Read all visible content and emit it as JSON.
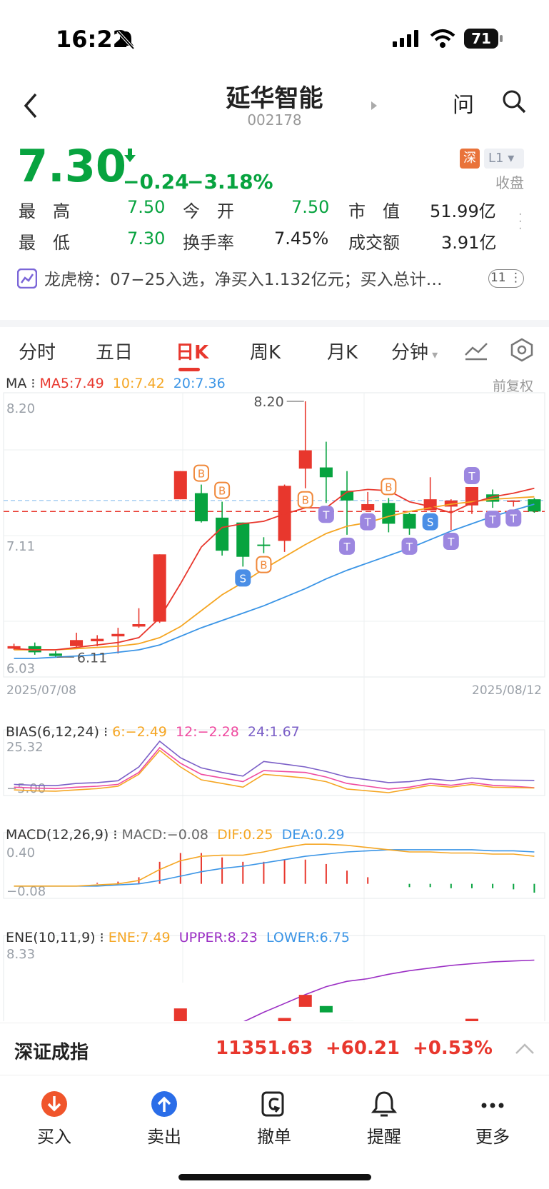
{
  "status_bar": {
    "time": "16:22",
    "battery": "71"
  },
  "header": {
    "title": "延华智能",
    "code": "002178",
    "ask": "问"
  },
  "quote": {
    "price": "7.30",
    "change": "−0.24",
    "change_pct": "−3.18%",
    "market_tag": "深",
    "level_tag": "L1",
    "state": "收盘",
    "rows": [
      [
        {
          "label": "最　高",
          "value": "7.50",
          "color": "green"
        },
        {
          "label": "今　开",
          "value": "7.50",
          "color": "green"
        },
        {
          "label": "市　值",
          "value": "51.99亿",
          "color": "dark"
        }
      ],
      [
        {
          "label": "最　低",
          "value": "7.30",
          "color": "green"
        },
        {
          "label": "换手率",
          "value": "7.45%",
          "color": "dark"
        },
        {
          "label": "成交额",
          "value": "3.91亿",
          "color": "dark"
        }
      ]
    ],
    "dragon_tiger": "龙虎榜：07−25入选，净买入1.132亿元；买入总计…",
    "dragon_tiger_count": "11"
  },
  "tabs": [
    "分时",
    "五日",
    "日K",
    "周K",
    "月K",
    "分钟"
  ],
  "active_tab": "日K",
  "chart_data": {
    "type": "candlestick",
    "adjust": "前复权",
    "ma_header": {
      "label": "MA",
      "ma5": "MA5:7.49",
      "ma10": "10:7.42",
      "ma20": "20:7.36"
    },
    "y_top_label": "8.20",
    "y_mid_label": "7.11",
    "y_bottom_label": "6.03",
    "high_label": "8.20",
    "low_label": "6.11",
    "start_date": "2025/07/08",
    "end_date": "2025/08/12",
    "ylim": [
      6.03,
      8.2
    ],
    "candles": [
      {
        "o": 6.18,
        "c": 6.2,
        "h": 6.22,
        "l": 6.17
      },
      {
        "o": 6.2,
        "c": 6.15,
        "h": 6.23,
        "l": 6.13
      },
      {
        "o": 6.14,
        "c": 6.12,
        "h": 6.16,
        "l": 6.11
      },
      {
        "o": 6.2,
        "c": 6.25,
        "h": 6.31,
        "l": 6.19
      },
      {
        "o": 6.24,
        "c": 6.26,
        "h": 6.29,
        "l": 6.2
      },
      {
        "o": 6.28,
        "c": 6.3,
        "h": 6.35,
        "l": 6.14
      },
      {
        "o": 6.36,
        "c": 6.38,
        "h": 6.51,
        "l": 6.35
      },
      {
        "o": 6.4,
        "c": 6.95,
        "h": 6.95,
        "l": 6.39
      },
      {
        "o": 7.4,
        "c": 7.63,
        "h": 7.63,
        "l": 7.4
      },
      {
        "o": 7.45,
        "c": 7.22,
        "h": 7.52,
        "l": 7.21
      },
      {
        "o": 7.25,
        "c": 6.98,
        "h": 7.38,
        "l": 6.94
      },
      {
        "o": 7.21,
        "c": 6.93,
        "h": 7.21,
        "l": 6.85
      },
      {
        "o": 7.03,
        "c": 7.02,
        "h": 7.09,
        "l": 6.96
      },
      {
        "o": 7.06,
        "c": 7.51,
        "h": 7.52,
        "l": 6.97
      },
      {
        "o": 7.65,
        "c": 7.8,
        "h": 8.2,
        "l": 7.49
      },
      {
        "o": 7.66,
        "c": 7.58,
        "h": 7.87,
        "l": 7.37
      },
      {
        "o": 7.47,
        "c": 7.39,
        "h": 7.63,
        "l": 7.11
      },
      {
        "o": 7.31,
        "c": 7.36,
        "h": 7.46,
        "l": 7.31
      },
      {
        "o": 7.37,
        "c": 7.2,
        "h": 7.41,
        "l": 7.13
      },
      {
        "o": 7.28,
        "c": 7.16,
        "h": 7.29,
        "l": 7.11
      },
      {
        "o": 7.31,
        "c": 7.4,
        "h": 7.58,
        "l": 7.31
      },
      {
        "o": 7.34,
        "c": 7.39,
        "h": 7.4,
        "l": 7.15
      },
      {
        "o": 7.35,
        "c": 7.5,
        "h": 7.5,
        "l": 7.28
      },
      {
        "o": 7.44,
        "c": 7.38,
        "h": 7.48,
        "l": 7.33
      },
      {
        "o": 7.39,
        "c": 7.39,
        "h": 7.39,
        "l": 7.34
      },
      {
        "o": 7.4,
        "c": 7.3,
        "h": 7.41,
        "l": 7.29
      }
    ],
    "ma5": [
      6.18,
      6.17,
      6.17,
      6.19,
      6.21,
      6.23,
      6.27,
      6.43,
      6.71,
      7.01,
      7.17,
      7.2,
      7.22,
      7.28,
      7.33,
      7.33,
      7.46,
      7.48,
      7.47,
      7.38,
      7.34,
      7.29,
      7.37,
      7.42,
      7.45,
      7.49
    ],
    "ma10": [
      6.17,
      6.17,
      6.17,
      6.18,
      6.19,
      6.2,
      6.22,
      6.27,
      6.36,
      6.49,
      6.62,
      6.72,
      6.83,
      6.93,
      7.03,
      7.12,
      7.18,
      7.21,
      7.26,
      7.3,
      7.33,
      7.36,
      7.38,
      7.4,
      7.41,
      7.42
    ],
    "ma20": [
      6.1,
      6.1,
      6.11,
      6.12,
      6.13,
      6.15,
      6.17,
      6.21,
      6.28,
      6.35,
      6.41,
      6.47,
      6.53,
      6.6,
      6.67,
      6.75,
      6.82,
      6.88,
      6.94,
      7.0,
      7.07,
      7.14,
      7.2,
      7.26,
      7.31,
      7.36
    ],
    "markers": [
      {
        "i": 9,
        "t": "B",
        "pos": "above"
      },
      {
        "i": 10,
        "t": "B",
        "pos": "above"
      },
      {
        "i": 11,
        "t": "S",
        "pos": "below"
      },
      {
        "i": 12,
        "t": "B",
        "pos": "below"
      },
      {
        "i": 14,
        "t": "B",
        "pos": "below"
      },
      {
        "i": 15,
        "t": "T",
        "pos": "below"
      },
      {
        "i": 16,
        "t": "T",
        "pos": "below"
      },
      {
        "i": 17,
        "t": "T",
        "pos": "below"
      },
      {
        "i": 18,
        "t": "B",
        "pos": "above"
      },
      {
        "i": 19,
        "t": "T",
        "pos": "below"
      },
      {
        "i": 20,
        "t": "S",
        "pos": "below"
      },
      {
        "i": 21,
        "t": "T",
        "pos": "below"
      },
      {
        "i": 22,
        "t": "T",
        "pos": "above"
      },
      {
        "i": 23,
        "t": "T",
        "pos": "below"
      },
      {
        "i": 24,
        "t": "T",
        "pos": "below"
      }
    ],
    "bias": {
      "header": {
        "label": "BIAS(6,12,24)",
        "b6": "6:−2.49",
        "b12": "12:−2.28",
        "b24": "24:1.67"
      },
      "top_label": "25.32",
      "bottom_label": "−5.00",
      "ylim": [
        -5.0,
        25.32
      ],
      "b6": [
        -3.5,
        -4.0,
        -4.2,
        -3.5,
        -2.8,
        -1.5,
        5.0,
        18.0,
        9.0,
        2.0,
        0.0,
        -2.0,
        5.0,
        4.0,
        3.0,
        1.0,
        -3.0,
        -4.0,
        -5.0,
        -3.0,
        -1.0,
        -2.0,
        -0.5,
        -2.0,
        -2.2,
        -2.49
      ],
      "b12": [
        -2.0,
        -2.5,
        -2.8,
        -2.0,
        -1.5,
        -0.5,
        6.0,
        19.5,
        11.0,
        5.0,
        3.0,
        1.0,
        7.0,
        6.5,
        6.0,
        3.5,
        0.0,
        -1.5,
        -3.0,
        -2.0,
        0.0,
        -1.0,
        0.5,
        -1.0,
        -1.5,
        -2.28
      ],
      "b24": [
        -0.5,
        -1.0,
        -1.2,
        0.0,
        0.5,
        1.5,
        9.0,
        23.0,
        14.0,
        8.5,
        6.0,
        4.0,
        12.0,
        10.5,
        9.0,
        6.5,
        3.5,
        2.0,
        0.5,
        1.0,
        2.5,
        1.5,
        3.0,
        2.0,
        1.8,
        1.67
      ]
    },
    "macd": {
      "header": {
        "label": "MACD(12,26,9)",
        "macd": "MACD:−0.08",
        "dif": "DIF:0.25",
        "dea": "DEA:0.29"
      },
      "top_label": "0.40",
      "bottom_label": "−0.08",
      "ylim": [
        -0.08,
        0.4
      ],
      "dif": [
        -0.02,
        -0.02,
        -0.02,
        -0.02,
        -0.01,
        0.0,
        0.03,
        0.13,
        0.21,
        0.25,
        0.26,
        0.26,
        0.29,
        0.33,
        0.36,
        0.36,
        0.35,
        0.33,
        0.31,
        0.29,
        0.29,
        0.28,
        0.28,
        0.27,
        0.27,
        0.25
      ],
      "dea": [
        -0.02,
        -0.02,
        -0.02,
        -0.02,
        -0.02,
        -0.01,
        0.0,
        0.03,
        0.07,
        0.11,
        0.14,
        0.16,
        0.19,
        0.22,
        0.25,
        0.27,
        0.29,
        0.3,
        0.31,
        0.31,
        0.31,
        0.31,
        0.31,
        0.3,
        0.3,
        0.29
      ],
      "hist": [
        0.0,
        0.0,
        0.0,
        0.0,
        0.01,
        0.02,
        0.06,
        0.2,
        0.28,
        0.28,
        0.24,
        0.2,
        0.2,
        0.22,
        0.22,
        0.18,
        0.12,
        0.06,
        0.0,
        -0.03,
        -0.03,
        -0.04,
        -0.04,
        -0.04,
        -0.05,
        -0.08
      ]
    },
    "ene": {
      "header": {
        "label": "ENE(10,11,9)",
        "ene": "ENE:7.49",
        "upper": "UPPER:8.23",
        "lower": "LOWER:6.75"
      },
      "top_label": "8.33"
    }
  },
  "index_bar": {
    "name": "深证成指",
    "value": "11351.63",
    "change": "+60.21",
    "pct": "+0.53%"
  },
  "bottom_nav": [
    {
      "label": "买入",
      "icon": "buy-icon"
    },
    {
      "label": "卖出",
      "icon": "sell-icon"
    },
    {
      "label": "撤单",
      "icon": "cancel-order-icon"
    },
    {
      "label": "提醒",
      "icon": "bell-icon"
    },
    {
      "label": "更多",
      "icon": "more-icon"
    }
  ],
  "colors": {
    "up": "#e8372d",
    "down": "#07a33f",
    "ma5": "#e8372d",
    "ma10": "#f5a623",
    "ma20": "#3b95e6",
    "bias24": "#7b5fc7",
    "bias12": "#ef4ba0",
    "upper": "#9b2fc4"
  }
}
